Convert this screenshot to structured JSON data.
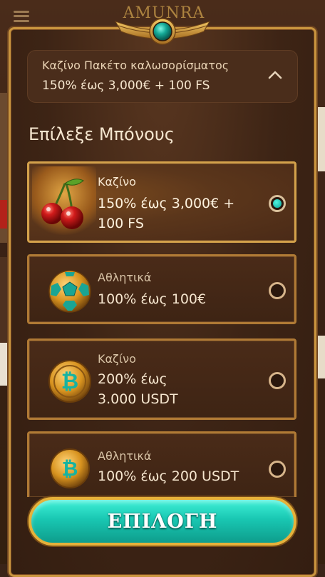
{
  "header": {
    "logo_text": "AMUNRA"
  },
  "package": {
    "title": "Καζίνο Πακέτο καλωσορίσματος",
    "summary": "150% έως 3,000€ + 100 FS",
    "chevron": "chevron-up-icon"
  },
  "section_title": "Επίλεξε Μπόνους",
  "bonuses": [
    {
      "category": "Καζίνο",
      "offer": "150% έως 3,000€ +\n100 FS",
      "icon": "cherries-icon",
      "selected": true
    },
    {
      "category": "Αθλητικά",
      "offer": "100% έως 100€",
      "icon": "football-icon",
      "selected": false
    },
    {
      "category": "Καζίνο",
      "offer": "200% έως\n3.000 USDT",
      "icon": "bitcoin-coin-icon",
      "selected": false
    },
    {
      "category": "Αθλητικά",
      "offer": "100% έως 200 USDT",
      "icon": "bitcoin-coin-icon",
      "selected": false
    }
  ],
  "select_button": "ΕΠΙΛΟΓΗ",
  "colors": {
    "accent": "#19c7b2",
    "gold": "#c9953f",
    "panel": "#3d2415"
  }
}
